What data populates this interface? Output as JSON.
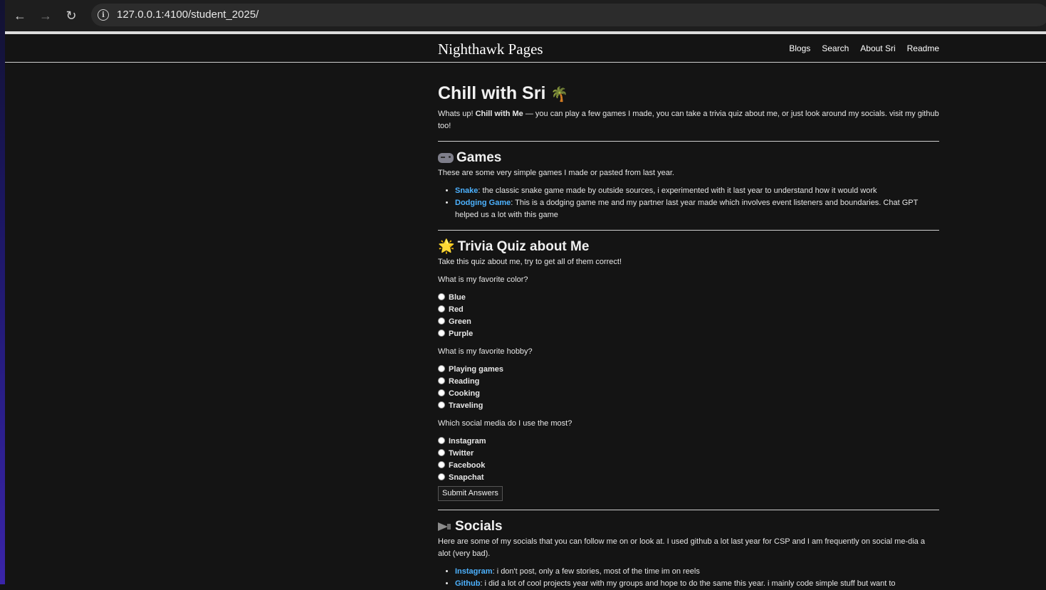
{
  "browser": {
    "url": "127.0.0.1:4100/student_2025/",
    "back_icon": "←",
    "forward_icon": "→",
    "reload_icon": "↻",
    "info_icon": "i"
  },
  "site": {
    "title": "Nighthawk Pages",
    "nav": [
      "Blogs",
      "Search",
      "About Sri",
      "Readme"
    ]
  },
  "intro": {
    "heading": "Chill with Sri",
    "heading_emoji": "🌴",
    "text_before": "Whats up! ",
    "text_bold": "Chill with Me",
    "text_after": " — you can play a few games I made, you can take a trivia quiz about me, or just look around my socials. visit my github too!"
  },
  "games": {
    "heading": "Games",
    "icon": "game-controller-icon",
    "description": "These are some very simple games I made or pasted from last year.",
    "items": [
      {
        "link": "Snake",
        "text": ": the classic snake game made by outside sources, i experimented with it last year to understand how it would work"
      },
      {
        "link": "Dodging Game",
        "text": ": This is a dodging game me and my partner last year made which involves event listeners and boundaries. Chat GPT helped us a lot with this game"
      }
    ]
  },
  "quiz": {
    "heading": "Trivia Quiz about Me",
    "icon_glyph": "🌟",
    "description": "Take this quiz about me, try to get all of them correct!",
    "questions": [
      {
        "q": "What is my favorite color?",
        "options": [
          "Blue",
          "Red",
          "Green",
          "Purple"
        ]
      },
      {
        "q": "What is my favorite hobby?",
        "options": [
          "Playing games",
          "Reading",
          "Cooking",
          "Traveling"
        ]
      },
      {
        "q": "Which social media do I use the most?",
        "options": [
          "Instagram",
          "Twitter",
          "Facebook",
          "Snapchat"
        ]
      }
    ],
    "submit_label": "Submit Answers"
  },
  "socials": {
    "heading": "Socials",
    "icon": "megaphone-icon",
    "description": "Here are some of my socials that you can follow me on or look at. I used github a lot last year for CSP and I am frequently on social me-dia a alot (very bad).",
    "items": [
      {
        "link": "Instagram",
        "text": ": i don't post, only a few stories, most of the time im on reels"
      },
      {
        "link": "Github",
        "text": ": i did a lot of cool projects year with my groups and hope to do the same this year. i mainly code simple stuff but want to"
      }
    ]
  },
  "colors": {
    "link": "#4db2ff",
    "background": "#141414",
    "text": "#e6e6e6"
  }
}
